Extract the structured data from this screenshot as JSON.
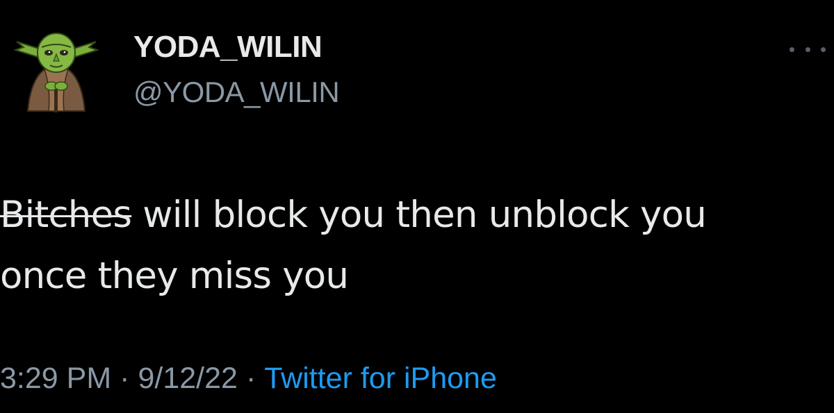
{
  "tweet": {
    "display_name": "YODA_WILIN",
    "handle": "@YODA_WILIN",
    "text_struck": "Bitches",
    "text_line1_rest": " will block you then unblock you",
    "text_line2": "once they miss you",
    "time": "3:29 PM",
    "date": "9/12/22",
    "separator": "·",
    "source": "Twitter for iPhone"
  },
  "icons": {
    "avatar": "yoda-avatar-icon",
    "more": "more-options-icon"
  },
  "colors": {
    "background": "#000000",
    "primary_text": "#e7e9ea",
    "secondary_text": "#8b98a5",
    "link": "#1d9bf0"
  }
}
